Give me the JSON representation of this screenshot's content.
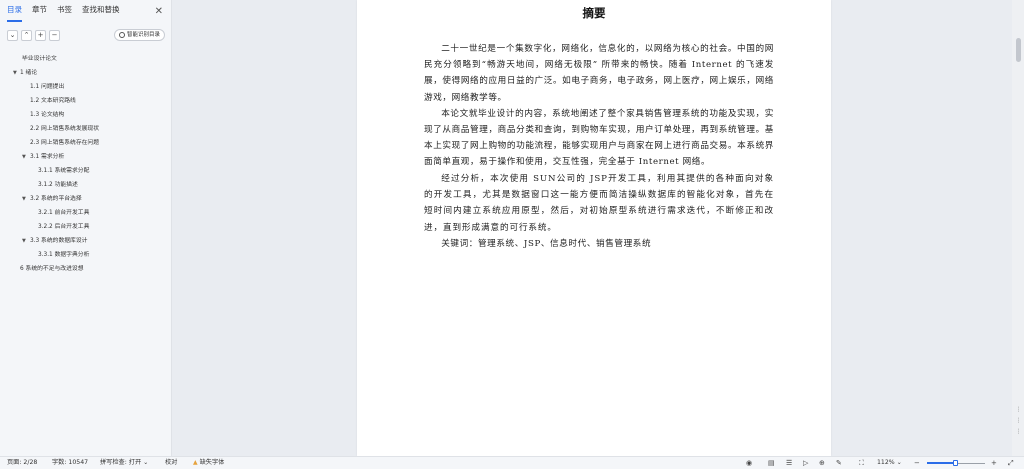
{
  "sidebar": {
    "tabs": [
      {
        "label": "目录",
        "active": true
      },
      {
        "label": "章节"
      },
      {
        "label": "书签"
      },
      {
        "label": "查找和替换"
      }
    ],
    "close": "✕",
    "toolbar": {
      "collapse": "⌄",
      "expand": "⌃",
      "add": "+",
      "remove": "−",
      "smart_label": "智能识别目录"
    },
    "toc": [
      {
        "label": "毕业设计论文",
        "level": 0
      },
      {
        "label": "1 绪论",
        "level": 1,
        "expanded": true
      },
      {
        "label": "1.1 问题提出",
        "level": 2
      },
      {
        "label": "1.2 文本研究路线",
        "level": 2
      },
      {
        "label": "1.3 论文结构",
        "level": 2
      },
      {
        "label": "2.2 网上销售系统发展现状",
        "level": 2
      },
      {
        "label": "2.3 网上销售系统存在问题",
        "level": 2
      },
      {
        "label": "3.1 需求分析",
        "level": 2,
        "expanded": true
      },
      {
        "label": "3.1.1 系统需求分配",
        "level": 3
      },
      {
        "label": "3.1.2 功能描述",
        "level": 3
      },
      {
        "label": "3.2 系统的平台选择",
        "level": 2,
        "expanded": true
      },
      {
        "label": "3.2.1 前台开发工具",
        "level": 3
      },
      {
        "label": "3.2.2 后台开发工具",
        "level": 3
      },
      {
        "label": "3.3 系统的数据库设计",
        "level": 2,
        "expanded": true
      },
      {
        "label": "3.3.1 数据字典分析",
        "level": 3
      },
      {
        "label": "6 系统的不足与改进设想",
        "level": 1
      }
    ]
  },
  "document": {
    "title": "摘要",
    "paragraphs": [
      "二十一世纪是一个集数字化，网络化，信息化的，以网络为核心的社会。中国的网民充分领略到“畅游天地间，网络无极限” 所带来的畅快。随着 Internet 的飞速发展，使得网络的应用日益的广泛。如电子商务，电子政务，网上医疗，网上娱乐，网络游戏，网络教学等。",
      "本论文就毕业设计的内容，系统地阐述了整个家具销售管理系统的功能及实现，实现了从商品管理，商品分类和查询，到购物车实现，用户订单处理，再到系统管理。基本上实现了网上购物的功能流程，能够实现用户与商家在网上进行商品交易。本系统界面简单直观，易于操作和使用，交互性强，完全基于 Internet 网络。",
      "经过分析，本次使用 SUN公司的 JSP开发工具，利用其提供的各种面向对象的开发工具，尤其是数据窗口这一能方便而简洁操纵数据库的智能化对象，首先在短时间内建立系统应用原型，然后，对初始原型系统进行需求迭代，不断修正和改进，直到形成满意的可行系统。",
      "关键词：管理系统、JSP、信息时代、销售管理系统"
    ]
  },
  "statusbar": {
    "page": "页面: 2/28",
    "words": "字数: 10547",
    "spell": "拼写检查: 打开 ⌄",
    "proof": "校对",
    "missing_font": "缺失字体",
    "zoom": "112% ⌄",
    "zoom_level_percent": 112,
    "minus": "−",
    "plus": "+"
  }
}
